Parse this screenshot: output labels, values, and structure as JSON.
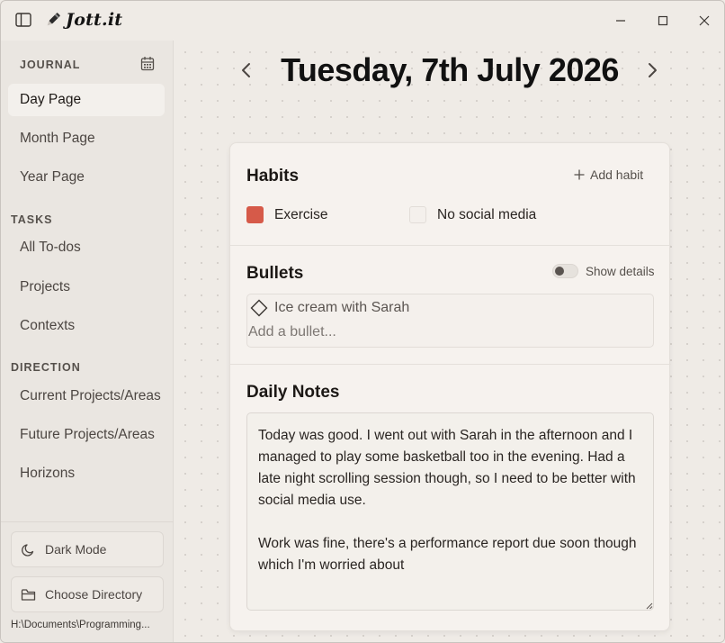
{
  "app": {
    "name": "Jott.it",
    "icons": {
      "sidebar_toggle": "sidebar-toggle-icon",
      "logo": "pen-icon"
    },
    "window_controls": [
      "minimize-icon",
      "maximize-icon",
      "close-icon"
    ]
  },
  "sidebar": {
    "journal_heading": "JOURNAL",
    "journal_items": [
      {
        "label": "Day Page",
        "active": true
      },
      {
        "label": "Month Page",
        "active": false
      },
      {
        "label": "Year Page",
        "active": false
      }
    ],
    "tasks_heading": "TASKS",
    "tasks_items": [
      {
        "label": "All To-dos"
      },
      {
        "label": "Projects"
      },
      {
        "label": "Contexts"
      }
    ],
    "direction_heading": "DIRECTION",
    "direction_items": [
      {
        "label": "Current Projects/Areas"
      },
      {
        "label": "Future Projects/Areas"
      },
      {
        "label": "Horizons"
      }
    ],
    "dark_mode_label": "Dark Mode",
    "choose_directory_label": "Choose Directory",
    "directory_path": "H:\\Documents\\Programming..."
  },
  "main": {
    "date_title": "Tuesday, 7th July 2026",
    "habits": {
      "heading": "Habits",
      "add_label": "Add habit",
      "items": [
        {
          "label": "Exercise",
          "done": true,
          "color": "#d65a49"
        },
        {
          "label": "No social media",
          "done": false,
          "color": "#f4f0ec"
        }
      ]
    },
    "bullets": {
      "heading": "Bullets",
      "show_details_label": "Show details",
      "show_details_on": false,
      "items": [
        {
          "text": "Ice cream with Sarah",
          "icon": "diamond-icon"
        }
      ],
      "input_placeholder": "Add a bullet..."
    },
    "daily_notes": {
      "heading": "Daily Notes",
      "text": "Today was good. I went out with Sarah in the afternoon and I managed to play some basketball too in the evening. Had a late night scrolling session though, so I need to be better with social media use.\n\nWork was fine, there's a performance report due soon though which I'm worried about"
    }
  },
  "colors": {
    "accent_habit_done": "#d65a49",
    "background": "#efebe6",
    "card": "#f6f2ee"
  }
}
